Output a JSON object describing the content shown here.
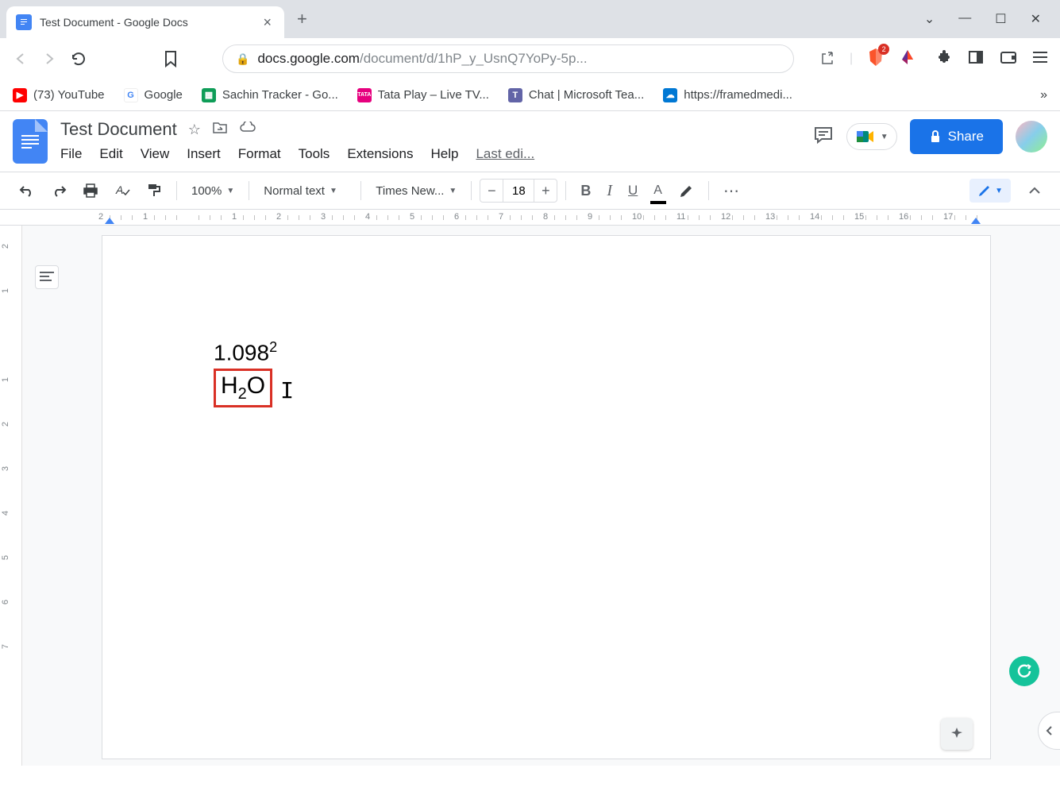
{
  "browser": {
    "tab_title": "Test Document - Google Docs",
    "url_host": "docs.google.com",
    "url_path": "/document/d/1hP_y_UsnQ7YoPy-5p...",
    "brave_badge": "2"
  },
  "bookmarks": [
    {
      "label": "(73) YouTube",
      "color": "#ff0000"
    },
    {
      "label": "Google",
      "color": "#4285f4"
    },
    {
      "label": "Sachin Tracker - Go...",
      "color": "#0f9d58"
    },
    {
      "label": "Tata Play – Live TV...",
      "color": "#e91e63"
    },
    {
      "label": "Chat | Microsoft Tea...",
      "color": "#6264a7"
    },
    {
      "label": "https://framedmedi...",
      "color": "#0078d4"
    }
  ],
  "doc": {
    "title": "Test Document",
    "menus": [
      "File",
      "Edit",
      "View",
      "Insert",
      "Format",
      "Tools",
      "Extensions",
      "Help"
    ],
    "last_edit": "Last edi...",
    "share_label": "Share"
  },
  "toolbar": {
    "zoom": "100%",
    "style": "Normal text",
    "font": "Times New...",
    "font_size": "18"
  },
  "content": {
    "line1_base": "1.098",
    "line1_sup": "2",
    "line2_h": "H",
    "line2_sub": "2",
    "line2_o": "O"
  },
  "ruler_h": [
    "2",
    "1",
    "",
    "1",
    "2",
    "3",
    "4",
    "5",
    "6",
    "7",
    "8",
    "9",
    "10",
    "11",
    "12",
    "13",
    "14",
    "15",
    "16",
    "17"
  ],
  "ruler_v": [
    "2",
    "1",
    "",
    "1",
    "2",
    "3",
    "4",
    "5",
    "6",
    "7"
  ]
}
